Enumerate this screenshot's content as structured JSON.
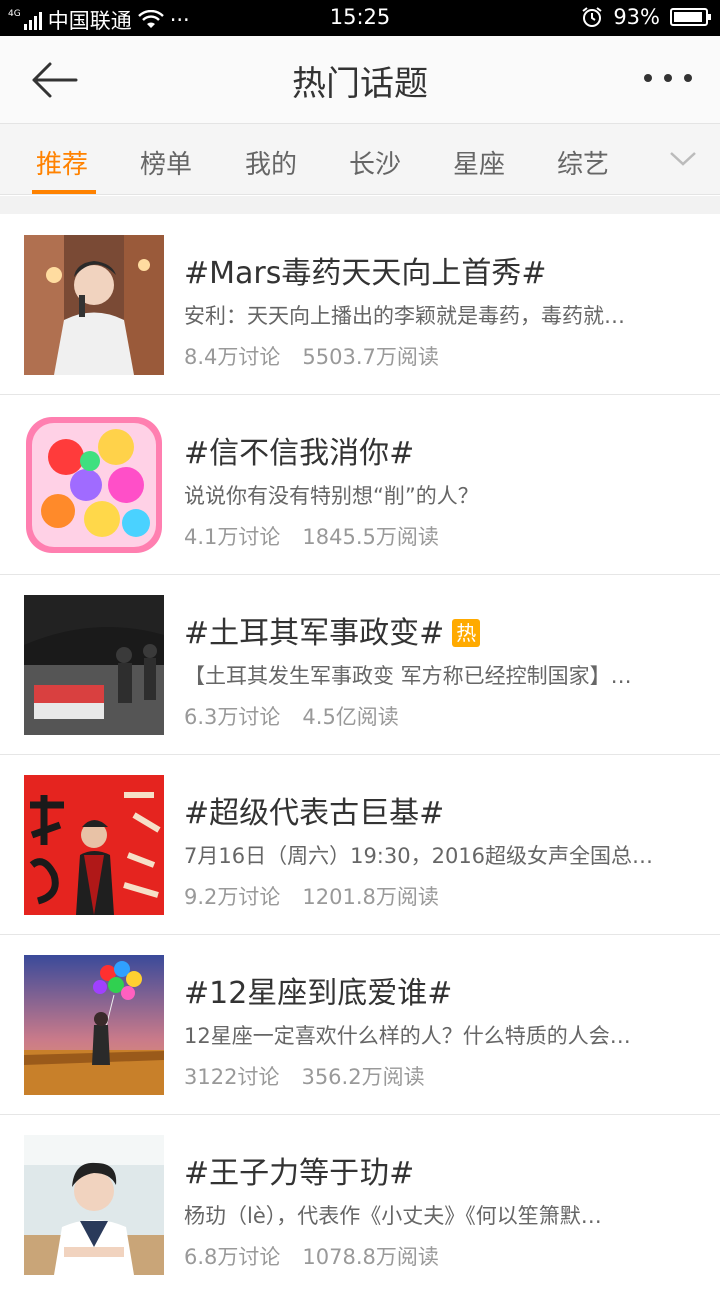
{
  "status_bar": {
    "network": "4G",
    "carrier": "中国联通",
    "dots": "···",
    "time": "15:25",
    "battery": "93%",
    "battery_level": 0.93
  },
  "header": {
    "title": "热门话题",
    "back_icon": "back-arrow-icon",
    "more_icon": "more-dots-icon"
  },
  "tabs": [
    {
      "label": "推荐",
      "active": true
    },
    {
      "label": "榜单"
    },
    {
      "label": "我的"
    },
    {
      "label": "长沙"
    },
    {
      "label": "星座"
    },
    {
      "label": "综艺"
    }
  ],
  "colors": {
    "accent": "#ff8200",
    "hot_badge": "#ffaa00"
  },
  "topics": [
    {
      "title": "#Mars毒药天天向上首秀#",
      "summary": "安利：天天向上播出的李颖就是毒药，毒药就…",
      "discussions": "8.4万讨论",
      "reads": "5503.7万阅读"
    },
    {
      "title": "#信不信我消你#",
      "summary": "说说你有没有特别想“削”的人？",
      "discussions": "4.1万讨论",
      "reads": "1845.5万阅读"
    },
    {
      "title": "#土耳其军事政变#",
      "badge": "热",
      "summary": "【土耳其发生军事政变 军方称已经控制国家】…",
      "discussions": "6.3万讨论",
      "reads": "4.5亿阅读"
    },
    {
      "title": "#超级代表古巨基#",
      "summary": "7月16日（周六）19:30，2016超级女声全国总…",
      "discussions": "9.2万讨论",
      "reads": "1201.8万阅读"
    },
    {
      "title": "#12星座到底爱谁#",
      "summary": "12星座一定喜欢什么样的人？什么特质的人会…",
      "discussions": "3122讨论",
      "reads": "356.2万阅读"
    },
    {
      "title": "#王子力等于玏#",
      "summary": "杨玏（lè），代表作《小丈夫》《何以笙箫默…",
      "discussions": "6.8万讨论",
      "reads": "1078.8万阅读"
    }
  ]
}
